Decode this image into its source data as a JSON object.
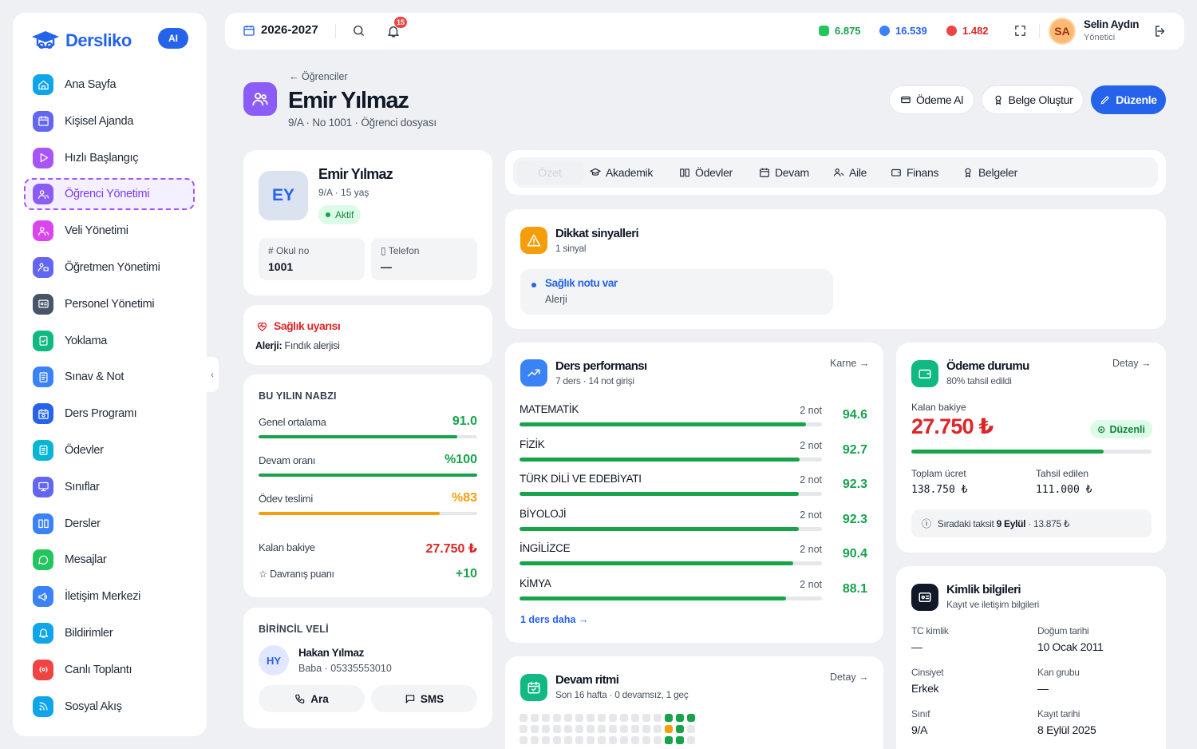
{
  "app": {
    "name": "Dersliko",
    "ai_label": "AI"
  },
  "sidebar": {
    "items": [
      {
        "label": "Ana Sayfa",
        "color": "#0ea5e9",
        "icon": "home-icon"
      },
      {
        "label": "Kişisel Ajanda",
        "color": "#6366f1",
        "icon": "calendar-icon"
      },
      {
        "label": "Hızlı Başlangıç",
        "color": "#a855f7",
        "icon": "play-icon"
      },
      {
        "label": "Öğrenci Yönetimi",
        "color": "#8b5cf6",
        "icon": "users-icon",
        "active": true
      },
      {
        "label": "Veli Yönetimi",
        "color": "#d946ef",
        "icon": "users-icon"
      },
      {
        "label": "Öğretmen Yönetimi",
        "color": "#6366f1",
        "icon": "teacher-icon"
      },
      {
        "label": "Personel Yönetimi",
        "color": "#475569",
        "icon": "id-card-icon"
      },
      {
        "label": "Yoklama",
        "color": "#10b981",
        "icon": "clipboard-check-icon"
      },
      {
        "label": "Sınav & Not",
        "color": "#3b82f6",
        "icon": "document-icon"
      },
      {
        "label": "Ders Programı",
        "color": "#2563eb",
        "icon": "calendar-clock-icon"
      },
      {
        "label": "Ödevler",
        "color": "#06b6d4",
        "icon": "clipboard-icon"
      },
      {
        "label": "Sınıflar",
        "color": "#6366f1",
        "icon": "monitor-icon"
      },
      {
        "label": "Dersler",
        "color": "#3b82f6",
        "icon": "book-icon"
      },
      {
        "label": "Mesajlar",
        "color": "#22c55e",
        "icon": "message-icon"
      },
      {
        "label": "İletişim Merkezi",
        "color": "#3b82f6",
        "icon": "megaphone-icon"
      },
      {
        "label": "Bildirimler",
        "color": "#0ea5e9",
        "icon": "bell-icon"
      },
      {
        "label": "Canlı Toplantı",
        "color": "#ef4444",
        "icon": "broadcast-icon"
      },
      {
        "label": "Sosyal Akış",
        "color": "#0ea5e9",
        "icon": "rss-icon"
      }
    ]
  },
  "topbar": {
    "year": "2026-2027",
    "notifications": "15",
    "stats": [
      {
        "value": "6.875",
        "color": "#16a34a"
      },
      {
        "value": "16.539",
        "color": "#2563eb"
      },
      {
        "value": "1.482",
        "color": "#dc2626"
      }
    ],
    "user": {
      "initials": "SA",
      "name": "Selin Aydın",
      "role": "Yönetici"
    }
  },
  "header": {
    "back": "Öğrenciler",
    "title": "Emir Yılmaz",
    "class": "9/A",
    "number": "No 1001",
    "type": "Öğrenci dosyası",
    "buttons": {
      "pay": "Ödeme Al",
      "doc": "Belge Oluştur",
      "edit": "Düzenle"
    }
  },
  "profile": {
    "initials": "EY",
    "name": "Emir Yılmaz",
    "info": "9/A · 15 yaş",
    "status": "Aktif",
    "school_no_label": "Okul no",
    "school_no": "1001",
    "phone_label": "Telefon",
    "phone": "—"
  },
  "health": {
    "title": "Sağlık uyarısı",
    "label": "Alerji:",
    "text": "Fındık alerjisi"
  },
  "pulse": {
    "title": "BU YILIN NABZI",
    "rows": [
      {
        "label": "Genel ortalama",
        "value": "91.0",
        "pct": 91,
        "color": "#16a34a"
      },
      {
        "label": "Devam oranı",
        "value": "%100",
        "pct": 100,
        "color": "#16a34a"
      },
      {
        "label": "Ödev teslimi",
        "value": "%83",
        "pct": 83,
        "color": "#f59e0b"
      }
    ],
    "balance_label": "Kalan bakiye",
    "balance": "27.750 ₺",
    "behavior_label": "Davranış puanı",
    "behavior": "+10"
  },
  "parent": {
    "title": "BİRİNCİL VELİ",
    "initials": "HY",
    "name": "Hakan Yılmaz",
    "info": "Baba · 05335553010",
    "call": "Ara",
    "sms": "SMS"
  },
  "tabs": [
    "Özet",
    "Akademik",
    "Ödevler",
    "Devam",
    "Aile",
    "Finans",
    "Belgeler"
  ],
  "signals": {
    "title": "Dikkat sinyalleri",
    "sub": "1 sinyal",
    "item_title": "Sağlık notu var",
    "item_sub": "Alerji"
  },
  "performance": {
    "title": "Ders performansı",
    "sub": "7 ders · 14 not girişi",
    "link": "Karne",
    "more": "1 ders daha",
    "rows": [
      {
        "name": "MATEMATİK",
        "count": "2 not",
        "score": "94.6",
        "pct": 94.6
      },
      {
        "name": "FİZİK",
        "count": "2 not",
        "score": "92.7",
        "pct": 92.7
      },
      {
        "name": "TÜRK DİLİ VE EDEBİYATI",
        "count": "2 not",
        "score": "92.3",
        "pct": 92.3
      },
      {
        "name": "BİYOLOJİ",
        "count": "2 not",
        "score": "92.3",
        "pct": 92.3
      },
      {
        "name": "İNGİLİZCE",
        "count": "2 not",
        "score": "90.4",
        "pct": 90.4
      },
      {
        "name": "KİMYA",
        "count": "2 not",
        "score": "88.1",
        "pct": 88.1
      }
    ]
  },
  "payment": {
    "title": "Ödeme durumu",
    "sub": "80% tahsil edildi",
    "link": "Detay",
    "balance_label": "Kalan bakiye",
    "balance": "27.750 ₺",
    "status": "Düzenli",
    "pct": 80,
    "total_label": "Toplam ücret",
    "total": "138.750 ₺",
    "paid_label": "Tahsil edilen",
    "paid": "111.000 ₺",
    "next_prefix": "Sıradaki taksit",
    "next_date": "9 Eylül",
    "next_amount": "· 13.875 ₺"
  },
  "attendance": {
    "title": "Devam ritmi",
    "sub": "Son 16 hafta · 0 devamsız, 1 geç",
    "link": "Detay"
  },
  "identity": {
    "title": "Kimlik bilgileri",
    "sub": "Kayıt ve iletişim bilgileri",
    "fields": [
      {
        "label": "TC kimlik",
        "value": "—"
      },
      {
        "label": "Doğum tarihi",
        "value": "10 Ocak 2011"
      },
      {
        "label": "Cinsiyet",
        "value": "Erkek"
      },
      {
        "label": "Kan grubu",
        "value": "—"
      },
      {
        "label": "Sınıf",
        "value": "9/A"
      },
      {
        "label": "Kayıt tarihi",
        "value": "8 Eylül 2025"
      }
    ]
  }
}
